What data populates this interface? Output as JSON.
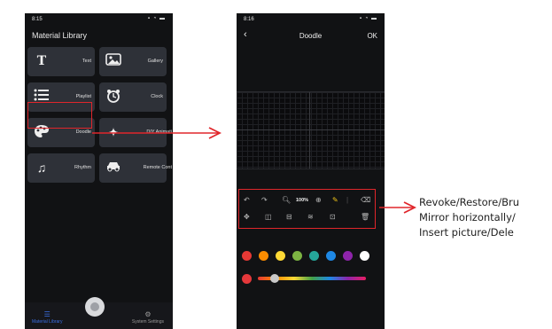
{
  "phone1": {
    "status": {
      "time": "8:15",
      "indicators": "▪ ◔ ▬"
    },
    "title": "Material Library",
    "tiles": [
      {
        "icon": "T",
        "icon_name": "text-icon",
        "label": "Text"
      },
      {
        "icon": "🖼",
        "icon_name": "gallery-icon",
        "label": "Gallery"
      },
      {
        "icon": "☰",
        "icon_name": "playlist-icon",
        "label": "Playlist"
      },
      {
        "icon": "⏰",
        "icon_name": "clock-icon",
        "label": "Clock"
      },
      {
        "icon": "🎨",
        "icon_name": "palette-icon",
        "label": "Doodle"
      },
      {
        "icon": "✦",
        "icon_name": "star-icon",
        "label": "DIY Animati"
      },
      {
        "icon": "♫",
        "icon_name": "music-icon",
        "label": "Rhythm"
      },
      {
        "icon": "⌂",
        "icon_name": "car-icon",
        "label": "Remote Cont"
      }
    ],
    "tabbar": {
      "library": "Material Library",
      "settings": "System Settings"
    }
  },
  "phone2": {
    "status": {
      "time": "8:16",
      "indicators": "▪ ◔ ▬"
    },
    "header": {
      "back": "‹",
      "title": "Doodle",
      "ok": "OK"
    },
    "toolbar": {
      "zoom": "100%"
    },
    "palette": [
      "#e53935",
      "#fb8c00",
      "#fdd835",
      "#7cb342",
      "#26a69a",
      "#1e88e5",
      "#8e24aa",
      "#ffffff"
    ],
    "current_color": "#e5383b"
  },
  "caption": {
    "line1": "Revoke/Restore/Bru",
    "line2": "Mirror horizontally/",
    "line3": "Insert  picture/Dele"
  },
  "colors": {
    "highlight": "#e0262b",
    "accent": "#3a6fe6"
  }
}
